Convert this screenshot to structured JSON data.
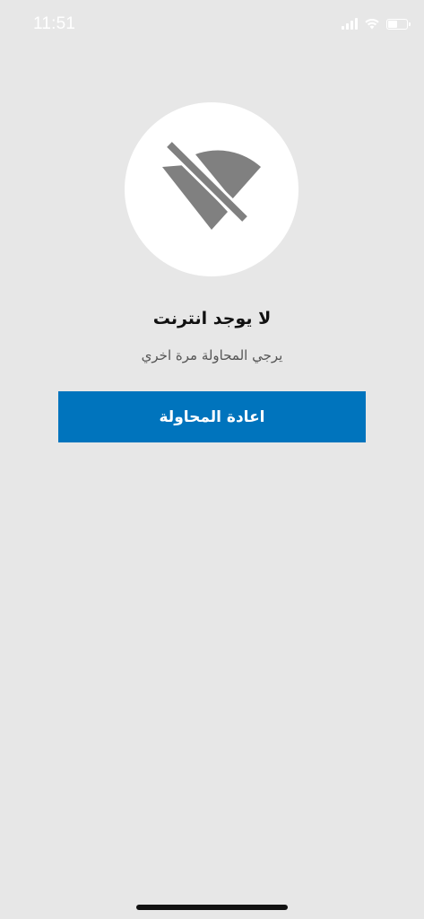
{
  "status_bar": {
    "time": "11:51",
    "icons": [
      "cellular-signal-icon",
      "wifi-icon",
      "battery-icon"
    ],
    "battery_level": 0.55
  },
  "offline_icon": {
    "name": "wifi-off-icon",
    "color": "#808080",
    "background": "#ffffff"
  },
  "message": {
    "title": "لا يوجد انترنت",
    "subtitle": "يرجي المحاولة مرة اخري"
  },
  "retry_button": {
    "label": "اعادة المحاولة",
    "color": "#0074bd"
  },
  "theme": {
    "background": "#e7e7e7"
  }
}
